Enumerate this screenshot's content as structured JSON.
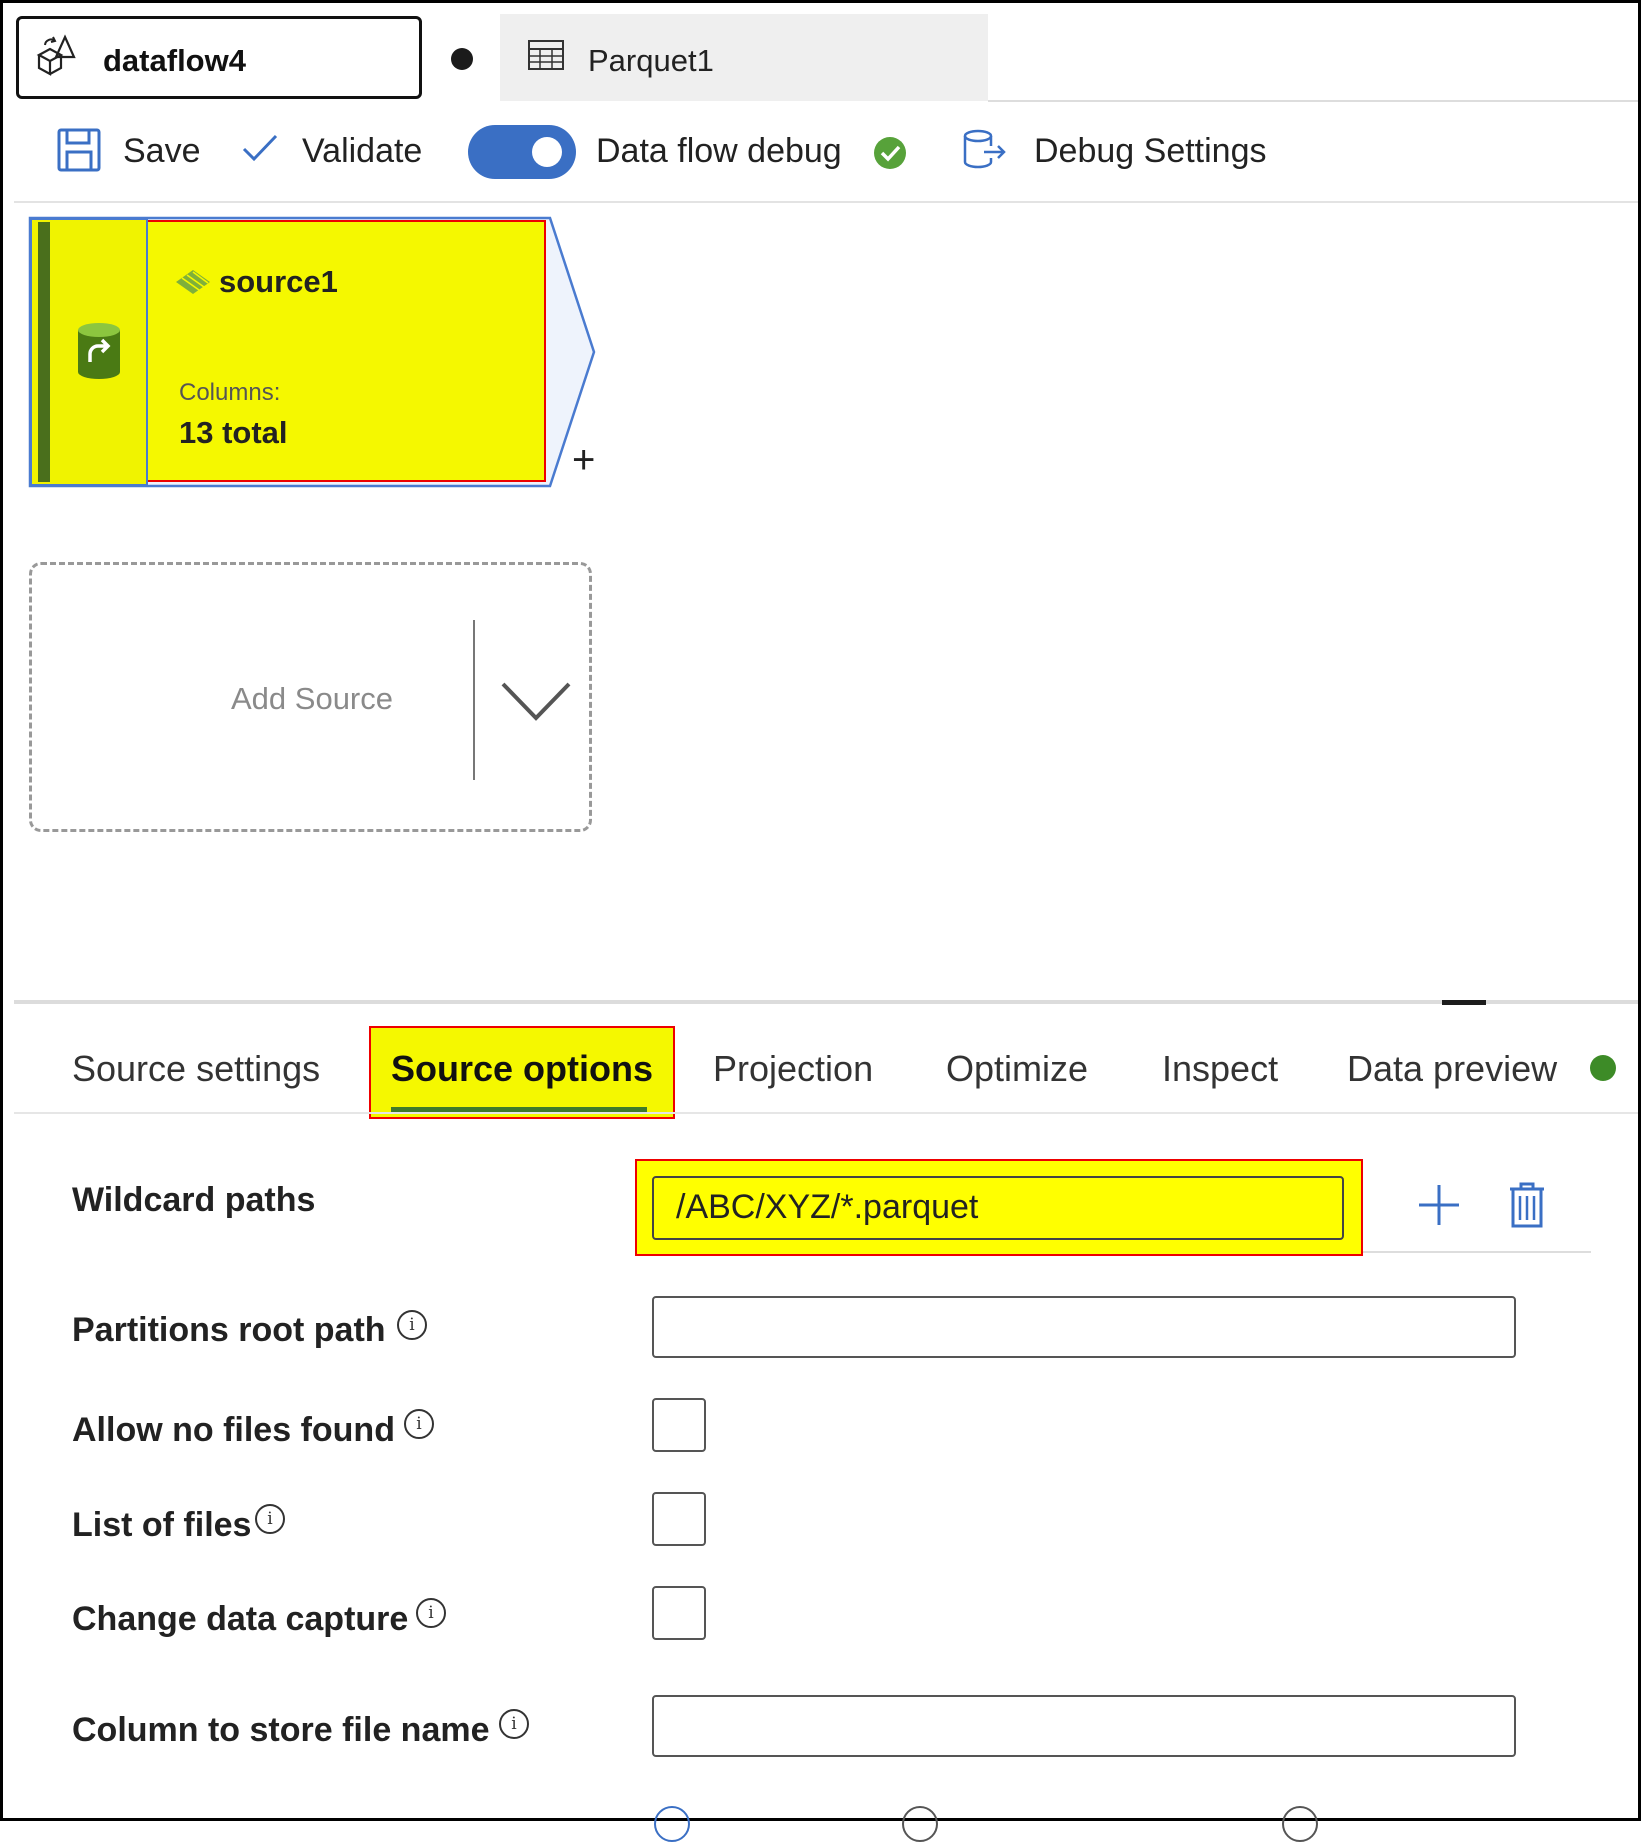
{
  "tabs": {
    "active": {
      "label": "dataflow4",
      "icon": "dataflow-icon",
      "unsaved": true
    },
    "second": {
      "label": "Parquet1",
      "icon": "table-icon"
    }
  },
  "toolbar": {
    "save_label": "Save",
    "validate_label": "Validate",
    "debug_label": "Data flow debug",
    "debug_enabled": true,
    "debug_status": "connected",
    "debug_settings_label": "Debug Settings"
  },
  "canvas": {
    "source_node": {
      "title": "source1",
      "columns_label": "Columns:",
      "columns_value": "13 total",
      "add_button": "+"
    },
    "add_source": {
      "label": "Add Source"
    }
  },
  "panel": {
    "tabs": [
      {
        "label": "Source settings"
      },
      {
        "label": "Source options"
      },
      {
        "label": "Projection"
      },
      {
        "label": "Optimize"
      },
      {
        "label": "Inspect"
      },
      {
        "label": "Data preview"
      }
    ],
    "active_tab": "Source options",
    "rows": {
      "wildcard": {
        "label": "Wildcard paths",
        "value": "/ABC/XYZ/*.parquet"
      },
      "partitions": {
        "label": "Partitions root path",
        "value": ""
      },
      "allow_no_files": {
        "label": "Allow no files found",
        "checked": false
      },
      "list_of_files": {
        "label": "List of files",
        "checked": false
      },
      "cdc": {
        "label": "Change data capture",
        "checked": false
      },
      "column_file_name": {
        "label": "Column to store file name",
        "value": ""
      }
    },
    "info_glyph": "i"
  },
  "colors": {
    "highlight_yellow": "#f5f800",
    "highlight_border": "#e00000",
    "accent_blue": "#3a6fc4",
    "status_green": "#3d8b27"
  }
}
